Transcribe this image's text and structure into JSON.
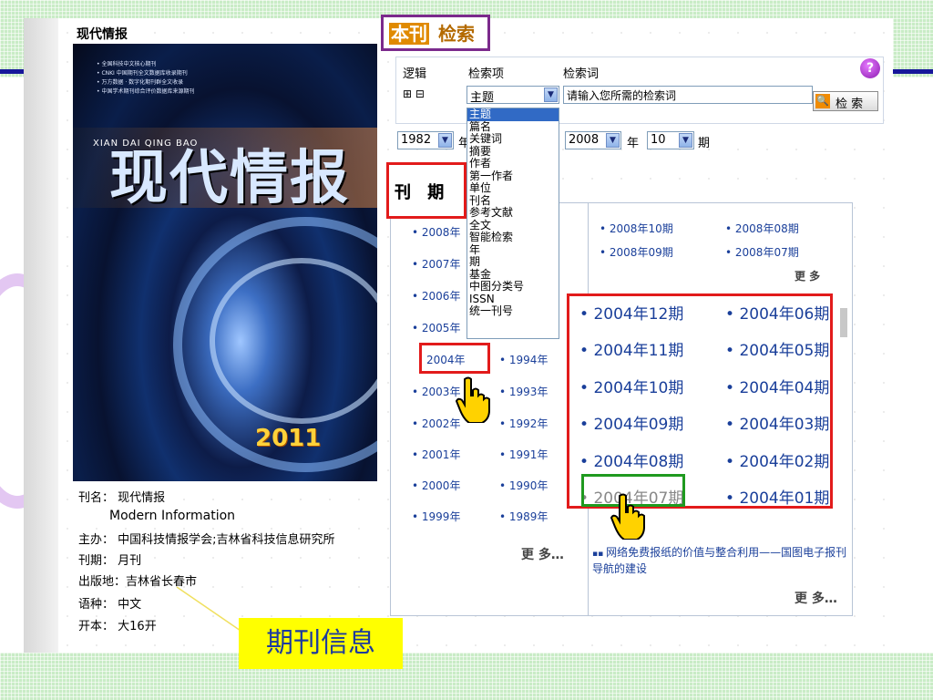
{
  "journal_header": "现代情报",
  "cover": {
    "pinyin": "XIAN DAI QING BAO",
    "title": "现代情报",
    "badge": "2011",
    "lines": [
      "• 全国科技中文核心期刊",
      "• CNKI 中国期刊全文数据库收录期刊",
      "• 万方数据 · 数字化期刊群全文收录",
      "• 中国学术期刊综合评价数据库来源期刊"
    ]
  },
  "info": {
    "name_label": "刊名：",
    "name_value": "现代情报",
    "english_name": "Modern Information",
    "sponsor_label": "主办：",
    "sponsor_value": "中国科技情报学会;吉林省科技信息研究所",
    "period_label": "刊期：",
    "period_value": "月刊",
    "place_label": "出版地：",
    "place_value": "吉林省长春市",
    "lang_label": "语种：",
    "lang_value": "中文",
    "size_label": "开本：",
    "size_value": "大16开"
  },
  "search": {
    "title_highlight": "本刊",
    "title_rest": "检索",
    "logic_label": "逻辑",
    "field_label": "检索项",
    "term_label": "检索词",
    "plus_minus": "⊞ ⊟",
    "field_selected": "主题",
    "term_value": "请输入您所需的检索词",
    "search_button": "检 索",
    "help_icon": "?",
    "year_from": "1982",
    "year_from_suffix": "年",
    "year_to": "2008",
    "year_to_suffix": "年",
    "issue": "10",
    "issue_suffix": "期",
    "dropdown_options": [
      "主题",
      "篇名",
      "关键词",
      "摘要",
      "作者",
      "第一作者",
      "单位",
      "刊名",
      "参考文献",
      "全文",
      "智能检索",
      "年",
      "期",
      "基金",
      "中图分类号",
      "ISSN",
      "统一刊号"
    ]
  },
  "issues_section": {
    "title": "刊 期",
    "years_left": [
      "2008年",
      "2007年",
      "2006年",
      "2005年",
      "2004年",
      "2003年",
      "2002年",
      "2001年",
      "2000年",
      "1999年"
    ],
    "years_right": [
      "1994年",
      "1993年",
      "1992年",
      "1991年",
      "1990年",
      "1989年"
    ],
    "more": "更 多…",
    "latest_issues": [
      "2008年10期",
      "2008年08期",
      "2008年09期",
      "2008年07期"
    ],
    "latest_more": "更 多",
    "year_2004_issues_left": [
      "2004年12期",
      "2004年11期",
      "2004年10期",
      "2004年09期",
      "2004年08期",
      "2004年07期"
    ],
    "year_2004_issues_right": [
      "2004年06期",
      "2004年05期",
      "2004年04期",
      "2004年03期",
      "2004年02期",
      "2004年01期"
    ],
    "article_link": "网络免费报纸的价值与整合利用——国图电子报刊导航的建设",
    "article_more": "更 多…"
  },
  "caption": "期刊信息",
  "colors": {
    "accent": "#1a3f9a",
    "highlight_red": "#e21b1b",
    "highlight_green": "#1f9a1f",
    "highlight_purple": "#7b2a8c",
    "caption_bg": "#ffff00"
  }
}
